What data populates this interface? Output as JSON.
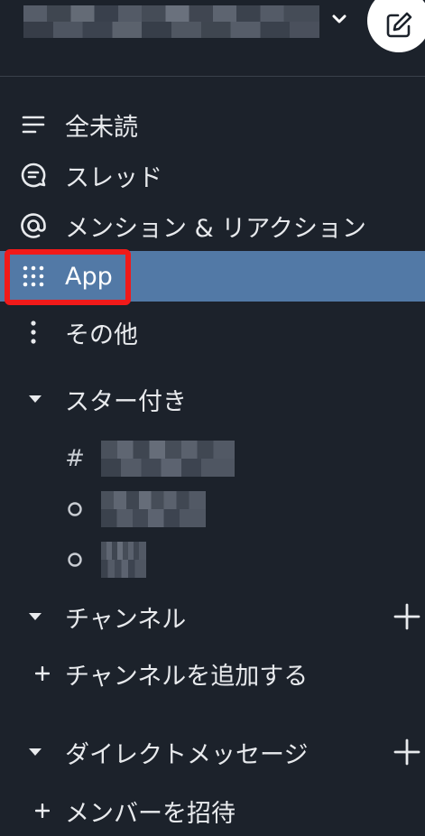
{
  "header": {
    "workspace_name": "",
    "chevron_icon": "chevron-down-icon",
    "compose_icon": "compose-icon"
  },
  "nav": {
    "items": [
      {
        "label": "全未読",
        "icon": "unread-list-icon"
      },
      {
        "label": "スレッド",
        "icon": "threads-icon"
      },
      {
        "label": "メンション & リアクション",
        "icon": "at-icon"
      },
      {
        "label": "App",
        "icon": "apps-grid-icon",
        "active": true
      },
      {
        "label": "その他",
        "icon": "more-vertical-icon"
      }
    ]
  },
  "starred": {
    "title": "スター付き",
    "channels": [
      {
        "prefix": "#"
      },
      {
        "prefix": "○"
      },
      {
        "prefix": "○"
      }
    ]
  },
  "channels": {
    "title": "チャンネル",
    "add_label": "チャンネルを追加する"
  },
  "dms": {
    "title": "ダイレクトメッセージ",
    "invite_label": "メンバーを招待"
  },
  "colors": {
    "background": "#1c222b",
    "active": "#5279a6",
    "highlight": "#f01a1a"
  }
}
